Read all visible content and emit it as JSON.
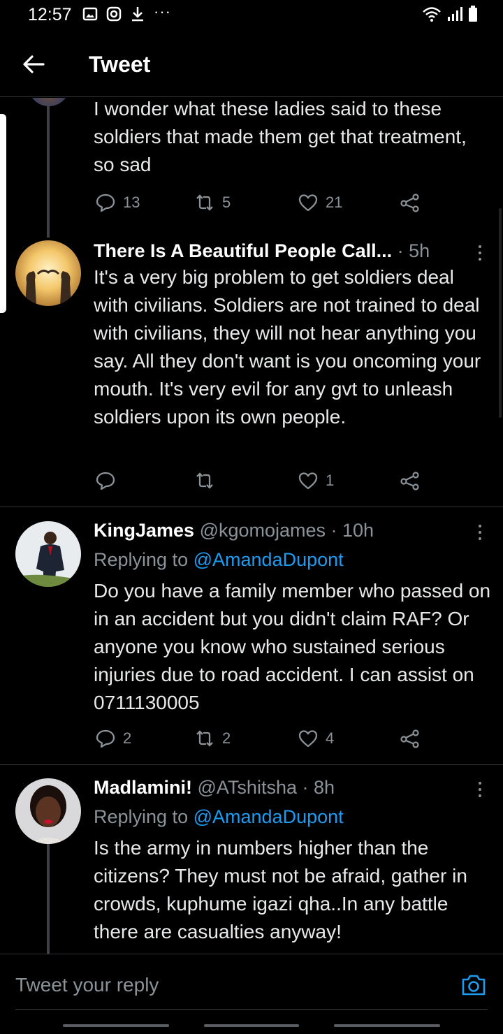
{
  "status_bar": {
    "time": "12:57",
    "more_dots": "···"
  },
  "header": {
    "title": "Tweet"
  },
  "tweets": [
    {
      "text": "I wonder what these ladies said to these soldiers that made them get that treatment, so sad",
      "replies": "13",
      "retweets": "5",
      "likes": "21"
    },
    {
      "name": "There Is A Beautiful People Call...",
      "meta": " · 5h",
      "text": "It's a very big problem to get soldiers deal with civilians. Soldiers are not trained to deal with civilians, they will not hear anything you say. All they don't want is you oncoming your mouth. It's very evil for any gvt to unleash soldiers upon its own people.",
      "replies": "",
      "retweets": "",
      "likes": "1"
    },
    {
      "name": "KingJames",
      "meta": " @kgomojames · 10h",
      "replying_label": "Replying to ",
      "replying_to": "@AmandaDupont",
      "text": "Do you have a family member who passed on in an accident but you didn't claim RAF? Or anyone you know who sustained serious injuries due to road accident. I can assist on 0711130005",
      "replies": "2",
      "retweets": "2",
      "likes": "4"
    },
    {
      "name": "Madlamini!",
      "meta": " @ATshitsha · 8h",
      "replying_label": "Replying to ",
      "replying_to": "@AmandaDupont",
      "text": "Is the army in numbers higher than the citizens? They must not be afraid, gather in crowds, kuphume igazi qha..In any battle there are casualties anyway!"
    }
  ],
  "reply_bar": {
    "placeholder": "Tweet your reply"
  },
  "colors": {
    "background": "#000000",
    "text": "#e7e9ea",
    "muted": "#8b9298",
    "accent": "#1d9bf0"
  }
}
